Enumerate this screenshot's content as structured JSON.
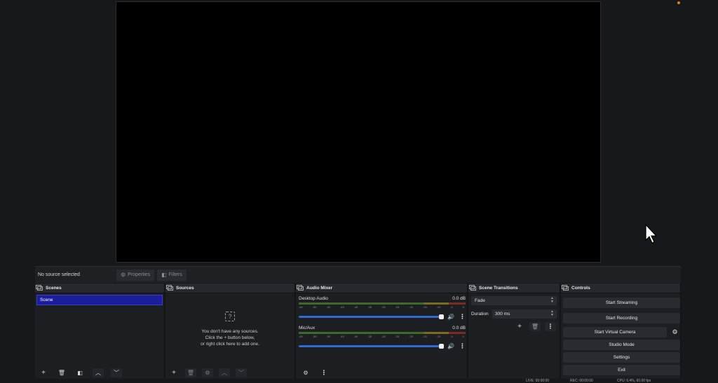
{
  "source_bar": {
    "no_source": "No source selected",
    "properties_label": "Properties",
    "filters_label": "Filters"
  },
  "scenes": {
    "title": "Scenes",
    "items": [
      {
        "label": "Scene"
      }
    ]
  },
  "sources": {
    "title": "Sources",
    "empty_line1": "You don't have any sources.",
    "empty_line2": "Click the + button below,",
    "empty_line3": "or right click here to add one."
  },
  "mixer": {
    "title": "Audio Mixer",
    "channels": [
      {
        "name": "Desktop Audio",
        "db": "0.0 dB",
        "volume": 1.0
      },
      {
        "name": "Mic/Aux",
        "db": "0.0 dB",
        "volume": 1.0
      }
    ],
    "ticks": [
      "-60",
      "-55",
      "-50",
      "-45",
      "-40",
      "-35",
      "-30",
      "-25",
      "-20",
      "-15",
      "-10",
      "-5",
      "0"
    ]
  },
  "transitions": {
    "title": "Scene Transitions",
    "selected": "Fade",
    "duration_label": "Duration",
    "duration_value": "300 ms"
  },
  "controls": {
    "title": "Controls",
    "start_streaming": "Start Streaming",
    "start_recording": "Start Recording",
    "start_virtual_camera": "Start Virtual Camera",
    "studio_mode": "Studio Mode",
    "settings": "Settings",
    "exit": "Exit"
  },
  "status": {
    "live": "LIVE: 00:00:00",
    "rec": "REC: 00:00:00",
    "cpu": "CPU: 0.4%, 60.00 fps"
  },
  "colors": {
    "selected_scene": "#1c1d9a",
    "volume_slider": "#2e6ccf",
    "tray_dot": "#e07b1f"
  }
}
